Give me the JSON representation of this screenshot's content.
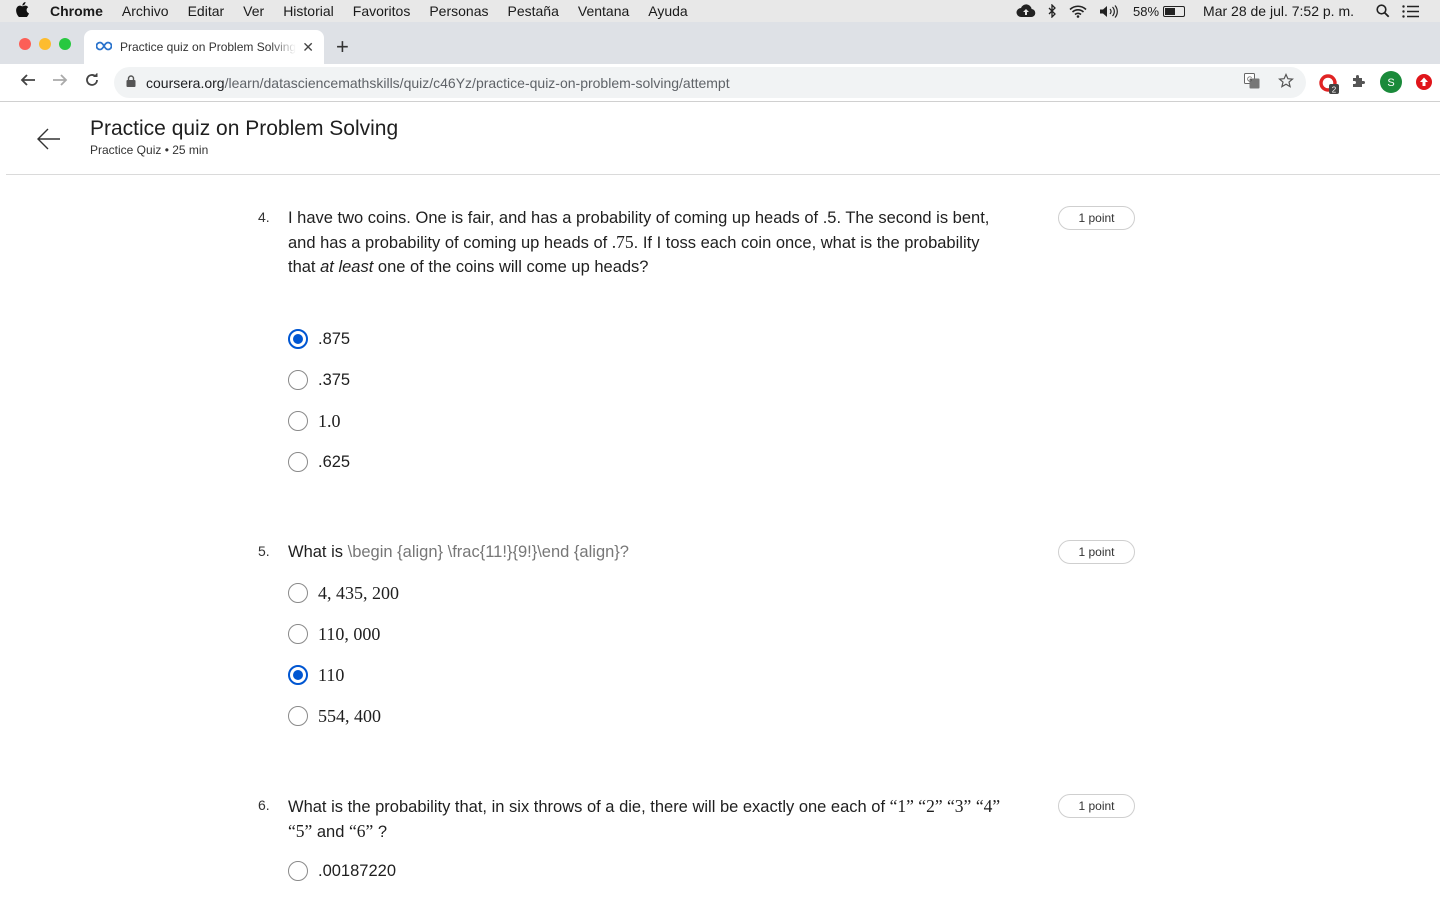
{
  "menubar": {
    "app": "Chrome",
    "items": [
      "Archivo",
      "Editar",
      "Ver",
      "Historial",
      "Favoritos",
      "Personas",
      "Pestaña",
      "Ventana",
      "Ayuda"
    ],
    "battery": "58%",
    "datetime": "Mar 28 de jul. 7:52 p. m.",
    "battery_level": 0.58
  },
  "tab": {
    "title": "Practice quiz on Problem Solving"
  },
  "toolbar": {
    "url_domain": "coursera.org",
    "url_path": "/learn/datasciencemathskills/quiz/c46Yz/practice-quiz-on-problem-solving/attempt",
    "extension_badge": "2",
    "profile_initial": "S"
  },
  "header": {
    "title": "Practice quiz on Problem Solving",
    "subtitle": "Practice Quiz • 25 min"
  },
  "questions": [
    {
      "number": "4.",
      "text_a": "I have two coins. One is fair, and has a probability of coming up heads of .5. The second is bent, and has a probability of coming up heads of ",
      "text_math": ".75",
      "text_b": ". If I toss each coin once, what is the probability that ",
      "text_em": "at least",
      "text_c": " one of the coins will come up heads?",
      "points": "1 point",
      "options": [
        {
          "label": ".875",
          "checked": true
        },
        {
          "label": ".375",
          "checked": false
        },
        {
          "label": "1.0",
          "checked": false
        },
        {
          "label": ".625",
          "checked": false
        }
      ]
    },
    {
      "number": "5.",
      "text_a": "What is ",
      "text_latex": "\\begin {align} \\frac{11!}{9!}\\end {align}?",
      "points": "1 point",
      "options": [
        {
          "label": "4, 435, 200",
          "checked": false
        },
        {
          "label": "110, 000",
          "checked": false
        },
        {
          "label": "110",
          "checked": true
        },
        {
          "label": "554, 400",
          "checked": false
        }
      ]
    },
    {
      "number": "6.",
      "text_a": "What is the probability that, in six throws of a die, there will be exactly one each of ",
      "text_math1": "“1”  “2”  “3”",
      "text_math2": "“4”  “5”",
      "text_and": " and ",
      "text_math3": "“6”",
      "text_end": " ?",
      "points": "1 point",
      "options": [
        {
          "label": ".00187220",
          "checked": false
        }
      ]
    }
  ]
}
